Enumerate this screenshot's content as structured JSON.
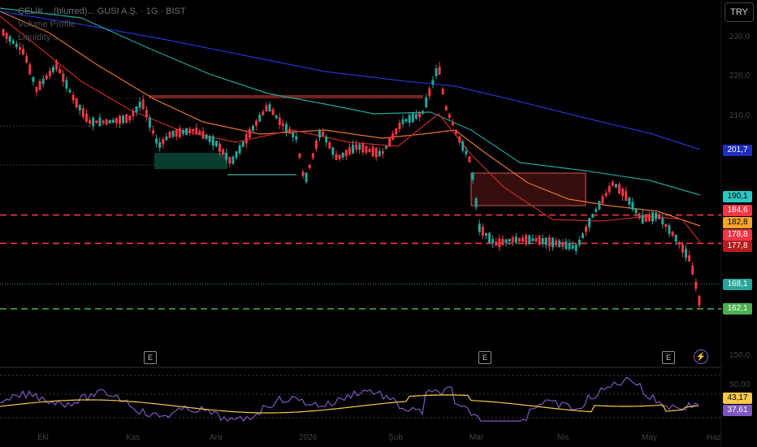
{
  "header": {
    "symbol_line": "ÇELİK ...(blurred)... GUSI A.Ş. · 1G · BIST",
    "line2": "Volume Profile",
    "line3": "Liquidity ..."
  },
  "currency_button": "TRY",
  "events": [
    {
      "name": "earnings-marker-1",
      "label": "E"
    },
    {
      "name": "earnings-marker-2",
      "label": "E"
    },
    {
      "name": "earnings-marker-3",
      "label": "E"
    }
  ],
  "price_tags": [
    {
      "name": "tag-201-7",
      "label": "201,7",
      "bg": "#1e2fbe",
      "fg": "#ffffff"
    },
    {
      "name": "tag-190-1",
      "label": "190,1",
      "bg": "#2cc7c4",
      "fg": "#000000"
    },
    {
      "name": "tag-184-6",
      "label": "184,6",
      "bg": "#f23645",
      "fg": "#ffffff"
    },
    {
      "name": "tag-182-8",
      "label": "182,8",
      "bg": "#f7a52b",
      "fg": "#000000"
    },
    {
      "name": "tag-178-8",
      "label": "178,8",
      "bg": "#f23645",
      "fg": "#ffffff"
    },
    {
      "name": "tag-177-8",
      "label": "177,8",
      "bg": "#b71c1c",
      "fg": "#ffffff"
    },
    {
      "name": "tag-168-1",
      "label": "168,1",
      "bg": "#26a69a",
      "fg": "#ffffff"
    },
    {
      "name": "tag-162-1",
      "label": "162,1",
      "bg": "#4caf50",
      "fg": "#ffffff"
    },
    {
      "name": "tag-43-17",
      "label": "43,17",
      "bg": "#f7c948",
      "fg": "#000000"
    },
    {
      "name": "tag-37-61",
      "label": "37,61",
      "bg": "#7e57c2",
      "fg": "#ffffff"
    }
  ],
  "y_axis_labels": [
    "230,0",
    "220,0",
    "210,0",
    "150,0",
    "50,00"
  ],
  "x_axis_labels": [
    "Eki",
    "Kas",
    "Ara",
    "2026",
    "Şub",
    "Mar",
    "Nis",
    "May",
    "Haz"
  ],
  "chart_data": {
    "type": "candlestick",
    "price_axis": {
      "ylim": [
        148,
        236
      ],
      "ticks": [
        230,
        220,
        210,
        150
      ]
    },
    "horizontal_levels": [
      {
        "name": "level-184-6",
        "value": 184.6,
        "color": "#f23645",
        "style": "dashed"
      },
      {
        "name": "level-177-8",
        "value": 177.8,
        "color": "#f23645",
        "style": "dashed"
      },
      {
        "name": "level-162-1",
        "value": 162.1,
        "color": "#4caf50",
        "style": "dashed"
      },
      {
        "name": "level-168-1",
        "value": 168.1,
        "color": "#26a69a",
        "style": "dotted"
      }
    ],
    "ma_series": [
      {
        "name": "blue-ma",
        "color": "#2433c9",
        "end_value": 201.7
      },
      {
        "name": "teal-ma",
        "color": "#1fa49a",
        "end_value": 190.1
      },
      {
        "name": "orange-ma",
        "color": "#e5742b",
        "end_value": 182.8
      },
      {
        "name": "red-ma",
        "color": "#c62828",
        "end_value": 177.8
      }
    ],
    "rsi": {
      "ylim": [
        0,
        100
      ],
      "rsi_end": 37.61,
      "ma_end": 43.17,
      "levels": [
        70,
        50,
        30
      ]
    },
    "colors": {
      "up": "#26a69a",
      "down": "#f23645"
    }
  }
}
